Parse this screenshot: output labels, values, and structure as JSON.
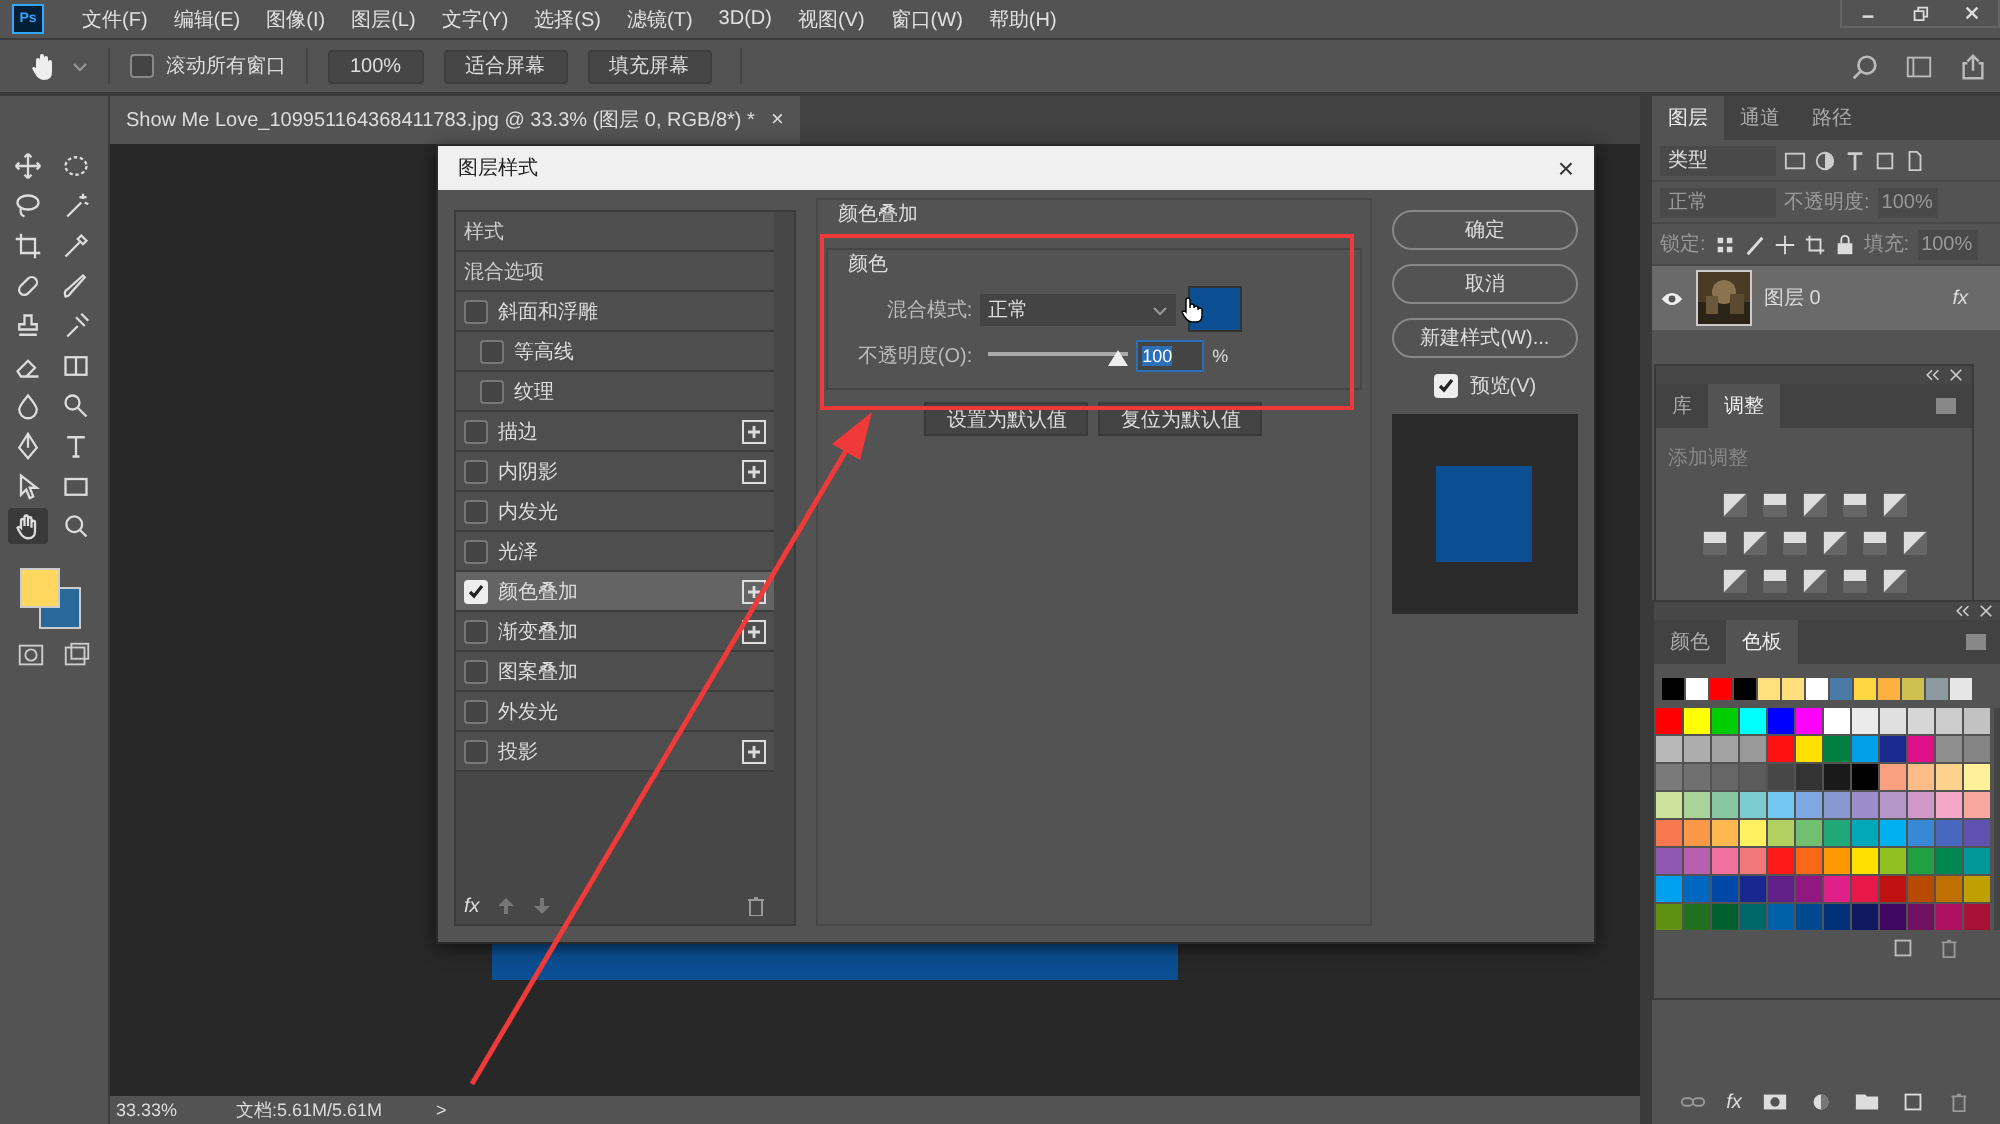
{
  "menu_bar": {
    "logo": "Ps",
    "items": [
      "文件(F)",
      "编辑(E)",
      "图像(I)",
      "图层(L)",
      "文字(Y)",
      "选择(S)",
      "滤镜(T)",
      "3D(D)",
      "视图(V)",
      "窗口(W)",
      "帮助(H)"
    ]
  },
  "options_bar": {
    "scroll_all": {
      "label": "滚动所有窗口",
      "checked": false
    },
    "buttons": [
      "100%",
      "适合屏幕",
      "填充屏幕"
    ]
  },
  "document_tab": {
    "title": "Show Me Love_109951164368411783.jpg @ 33.3% (图层 0, RGB/8*) *",
    "close": "×"
  },
  "toolbar": {
    "tools": [
      {
        "selected": false
      },
      {
        "selected": false
      },
      {
        "selected": false
      },
      {
        "selected": false
      },
      {
        "selected": false
      },
      {
        "selected": false
      },
      {
        "selected": false
      },
      {
        "selected": false
      },
      {
        "selected": false
      },
      {
        "selected": false
      },
      {
        "selected": false
      },
      {
        "selected": false
      },
      {
        "selected": false
      },
      {
        "selected": false
      },
      {
        "selected": false
      },
      {
        "selected": false
      },
      {
        "selected": false
      },
      {
        "selected": false
      },
      {
        "selected": true
      },
      {
        "selected": false
      }
    ]
  },
  "status_bar": {
    "zoom": "33.33%",
    "doc_size": "文档:5.61M/5.61M",
    "arrow": ">"
  },
  "dialog": {
    "title": "图层样式",
    "close": "×",
    "styles": [
      {
        "label": "样式",
        "kind": "header",
        "selected": false
      },
      {
        "label": "混合选项",
        "kind": "header",
        "selected": false
      },
      {
        "label": "斜面和浮雕",
        "kind": "effect",
        "checked": false,
        "selected": false,
        "addable": false,
        "children": [
          {
            "label": "等高线",
            "kind": "effect",
            "checked": false,
            "selected": false,
            "addable": false
          },
          {
            "label": "纹理",
            "kind": "effect",
            "checked": false,
            "selected": false,
            "addable": false
          }
        ]
      },
      {
        "label": "描边",
        "kind": "effect",
        "checked": false,
        "selected": false,
        "addable": true
      },
      {
        "label": "内阴影",
        "kind": "effect",
        "checked": false,
        "selected": false,
        "addable": true
      },
      {
        "label": "内发光",
        "kind": "effect",
        "checked": false,
        "selected": false,
        "addable": false
      },
      {
        "label": "光泽",
        "kind": "effect",
        "checked": false,
        "selected": false,
        "addable": false
      },
      {
        "label": "颜色叠加",
        "kind": "effect",
        "checked": true,
        "selected": true,
        "addable": true
      },
      {
        "label": "渐变叠加",
        "kind": "effect",
        "checked": false,
        "selected": false,
        "addable": true
      },
      {
        "label": "图案叠加",
        "kind": "effect",
        "checked": false,
        "selected": false,
        "addable": false
      },
      {
        "label": "外发光",
        "kind": "effect",
        "checked": false,
        "selected": false,
        "addable": false
      },
      {
        "label": "投影",
        "kind": "effect",
        "checked": false,
        "selected": false,
        "addable": true
      }
    ],
    "list_fx": "fx",
    "section_title": "颜色叠加",
    "group_title": "颜色",
    "blend_mode_label": "混合模式:",
    "blend_mode": "正常",
    "color": "#0b4f92",
    "opacity_label": "不透明度(O):",
    "opacity": {
      "level": 1.0
    },
    "opacity_value": "100",
    "percent": "%",
    "default_buttons": [
      "设置为默认值",
      "复位为默认值"
    ],
    "buttons": [
      "确定",
      "取消",
      "新建样式(W)..."
    ],
    "preview": {
      "label": "预览(V)",
      "checked": true
    }
  },
  "layers_panel": {
    "tabs": [
      {
        "label": "图层",
        "selected": true
      },
      {
        "label": "通道",
        "selected": false
      },
      {
        "label": "路径",
        "selected": false
      }
    ],
    "filter": "类型",
    "blend_mode": "正常",
    "opacity_label": "不透明度:",
    "opacity": "100%",
    "lock_label": "锁定:",
    "fill_label": "填充:",
    "fill": "100%",
    "layers": [
      {
        "name": "图层 0",
        "fx": "fx",
        "selected": true
      }
    ],
    "footer_fx": "fx"
  },
  "adjustments_panel": {
    "tabs": [
      {
        "label": "库",
        "selected": false
      },
      {
        "label": "调整",
        "selected": true
      }
    ],
    "hint": "添加调整"
  },
  "swatches_panel": {
    "tabs": [
      {
        "label": "颜色",
        "selected": false
      },
      {
        "label": "色板",
        "selected": true
      }
    ],
    "recent": [
      {
        "color": "#000000"
      },
      {
        "color": "#ffffff"
      },
      {
        "color": "#ff0000"
      },
      {
        "color": "#000000"
      },
      {
        "color": "#ffe07a"
      },
      {
        "color": "#ffe07a"
      },
      {
        "color": "#ffffff"
      },
      {
        "color": "#4a7aa8"
      },
      {
        "color": "#ffd740"
      },
      {
        "color": "#ffb040"
      },
      {
        "color": "#d0c050"
      },
      {
        "color": "#8c9aa0"
      },
      {
        "color": "#e6e6e6"
      }
    ],
    "rows": [
      [
        {
          "color": "#ff0000"
        },
        {
          "color": "#ffff00"
        },
        {
          "color": "#00cc00"
        },
        {
          "color": "#00ffff"
        },
        {
          "color": "#0000ff"
        },
        {
          "color": "#ff00ff"
        },
        {
          "color": "#ffffff"
        },
        {
          "color": "#ebebeb"
        },
        {
          "color": "#e0e0e0"
        },
        {
          "color": "#d6d6d6"
        },
        {
          "color": "#cccccc"
        },
        {
          "color": "#c2c2c2"
        }
      ],
      [
        {
          "color": "#b8b8b8"
        },
        {
          "color": "#adadad"
        },
        {
          "color": "#a3a3a3"
        },
        {
          "color": "#999999"
        },
        {
          "color": "#ff1010"
        },
        {
          "color": "#ffe000"
        },
        {
          "color": "#008040"
        },
        {
          "color": "#00a0e8"
        },
        {
          "color": "#1a2a90"
        },
        {
          "color": "#e0108a"
        },
        {
          "color": "#8f8f8f"
        },
        {
          "color": "#858585"
        }
      ],
      [
        {
          "color": "#7a7a7a"
        },
        {
          "color": "#707070"
        },
        {
          "color": "#666666"
        },
        {
          "color": "#5c5c5c"
        },
        {
          "color": "#474747"
        },
        {
          "color": "#333333"
        },
        {
          "color": "#1a1a1a"
        },
        {
          "color": "#000000"
        },
        {
          "color": "#f9a080"
        },
        {
          "color": "#fbbc88"
        },
        {
          "color": "#fdd28c"
        },
        {
          "color": "#fff099"
        }
      ],
      [
        {
          "color": "#cde39a"
        },
        {
          "color": "#a8d49a"
        },
        {
          "color": "#88c8a0"
        },
        {
          "color": "#7ccbd0"
        },
        {
          "color": "#72c8f0"
        },
        {
          "color": "#80a8e0"
        },
        {
          "color": "#8898d0"
        },
        {
          "color": "#9c8ccc"
        },
        {
          "color": "#b496c8"
        },
        {
          "color": "#d098c8"
        },
        {
          "color": "#f4a8c8"
        },
        {
          "color": "#f8a8a0"
        }
      ],
      [
        {
          "color": "#f87850"
        },
        {
          "color": "#fb9848"
        },
        {
          "color": "#fdb850"
        },
        {
          "color": "#fff060"
        },
        {
          "color": "#b0d060"
        },
        {
          "color": "#70c070"
        },
        {
          "color": "#20a878"
        },
        {
          "color": "#00a8b8"
        },
        {
          "color": "#00b0f0"
        },
        {
          "color": "#3888d8"
        },
        {
          "color": "#4868c0"
        },
        {
          "color": "#6050b0"
        }
      ],
      [
        {
          "color": "#9058b0"
        },
        {
          "color": "#b860b0"
        },
        {
          "color": "#f070a0"
        },
        {
          "color": "#f07878"
        },
        {
          "color": "#ff1a1a"
        },
        {
          "color": "#f86818"
        },
        {
          "color": "#ff9800"
        },
        {
          "color": "#ffe000"
        },
        {
          "color": "#90c020"
        },
        {
          "color": "#20a040"
        },
        {
          "color": "#008850"
        },
        {
          "color": "#009898"
        }
      ],
      [
        {
          "color": "#00a0f0"
        },
        {
          "color": "#0068c0"
        },
        {
          "color": "#0048a8"
        },
        {
          "color": "#182890"
        },
        {
          "color": "#602088"
        },
        {
          "color": "#901880"
        },
        {
          "color": "#e0208a"
        },
        {
          "color": "#e81848"
        },
        {
          "color": "#c01010"
        },
        {
          "color": "#b84a00"
        },
        {
          "color": "#c07000"
        },
        {
          "color": "#c0a000"
        }
      ],
      [
        {
          "color": "#609010"
        },
        {
          "color": "#207020"
        },
        {
          "color": "#006030"
        },
        {
          "color": "#006868"
        },
        {
          "color": "#0060a8"
        },
        {
          "color": "#004890"
        },
        {
          "color": "#003078"
        },
        {
          "color": "#101860"
        },
        {
          "color": "#400860"
        },
        {
          "color": "#701060"
        },
        {
          "color": "#b01060"
        },
        {
          "color": "#a81038"
        }
      ]
    ]
  }
}
